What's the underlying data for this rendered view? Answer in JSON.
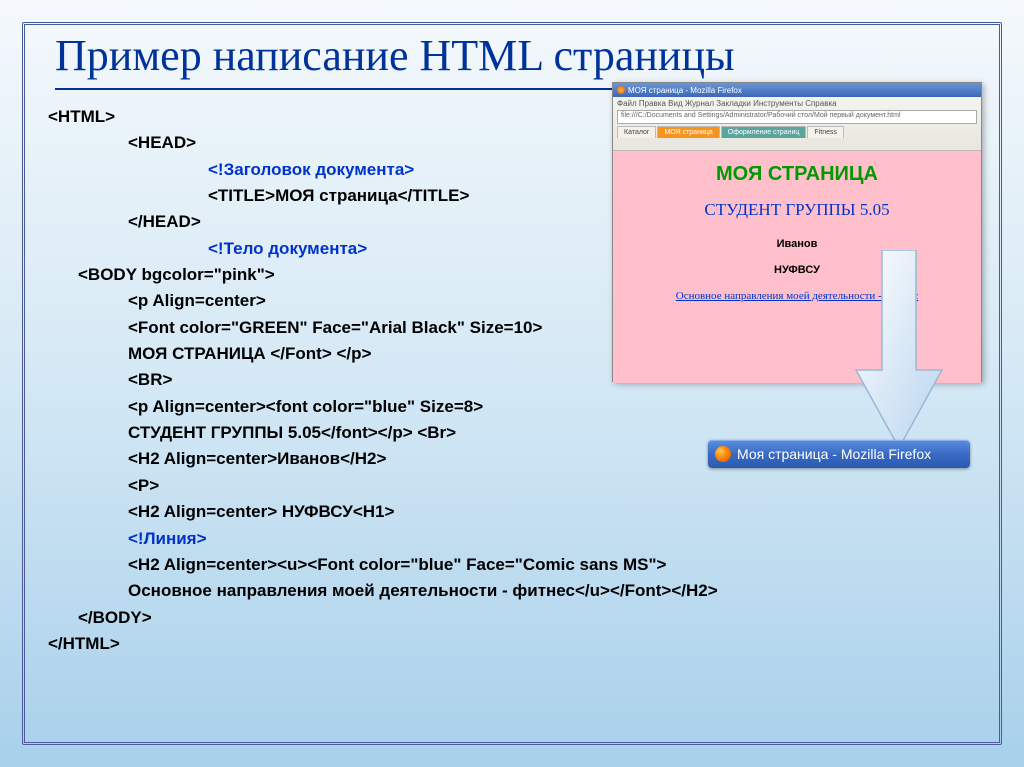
{
  "title": "Пример написание HTML страницы",
  "code": {
    "l01": "<HTML>",
    "l02": "<HEAD>",
    "l03": "<!Заголовок документа>",
    "l04": "<TITLE>МОЯ страница</TITLE>",
    "l05": "</HEAD>",
    "l06": "<!Тело документа>",
    "l07": "<BODY bgcolor=\"pink\">",
    "l08": "<p Align=center>",
    "l09": "<Font color=\"GREEN\" Face=\"Arial Black\" Size=10>",
    "l10": "МОЯ СТРАНИЦА </Font> </p>",
    "l11": "<BR>",
    "l12": "<p Align=center><font color=\"blue\" Size=8>",
    "l13": "СТУДЕНТ ГРУППЫ 5.05</font></p> <Br>",
    "l14": "<H2 Align=center>Иванов</H2>",
    "l15": "<P>",
    "l16": "<H2 Align=center> НУФВСУ<H1>",
    "l17": "<!Линия>",
    "l18": "<H2 Align=center><u><Font color=\"blue\" Face=\"Comic sans MS\">",
    "l19": "Основное направления моей деятельности - фитнес</u></Font></H2>",
    "l20": "</BODY>",
    "l21": "</HTML>"
  },
  "preview": {
    "window_title": "МОЯ страница - Mozilla Firefox",
    "menu": "Файл  Правка  Вид  Журнал  Закладки  Инструменты  Справка",
    "address": "file:///C:/Documents and Settings/Administrator/Рабочий стол/Мой первый документ.html",
    "tabs": [
      "Каталог",
      "МОЯ страница",
      "Оформление страниц",
      "Fitness"
    ],
    "h1": "МОЯ СТРАНИЦА",
    "h2": "СТУДЕНТ ГРУППЫ 5.05",
    "line1": "Иванов",
    "line2": "НУФВСУ",
    "link": "Основное направления моей деятельности - фитнес"
  },
  "taskbar": {
    "label": "Моя страница - Mozilla Firefox"
  }
}
